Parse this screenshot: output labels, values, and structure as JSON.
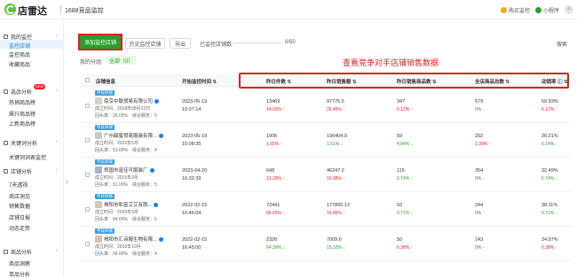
{
  "app": {
    "logo_text": "店雷达",
    "breadcrumb": "1688竞品监控"
  },
  "top_right": {
    "buy": "购买监控",
    "mini": "小程序",
    "avatar": "P"
  },
  "sidebar": {
    "groups": [
      {
        "label": "我的监控",
        "items": [
          "监控店铺",
          "监控商品",
          "收藏商品"
        ]
      },
      {
        "label": "选品分析",
        "badge": "NEW",
        "items": [
          "热销商品榜",
          "飙升商品榜",
          "上新商品榜"
        ]
      },
      {
        "label": "关键词分析",
        "items": [
          "关键词词表监控"
        ]
      },
      {
        "label": "店铺分析",
        "items": [
          "7天透视",
          "商店洞见",
          "销售数据",
          "店铺日报",
          "动态走势"
        ]
      },
      {
        "label": "商品分析",
        "items": [
          "商品洞察",
          "单品分析"
        ]
      }
    ]
  },
  "toolbar": {
    "add_label": "添加监控店铺",
    "history_label": "历史监控店铺",
    "export_label": "导出",
    "usage_label": "已监控店铺数:",
    "usage_value": "0",
    "usage_total": "/50",
    "usage_fraction": 0,
    "search_label": "搜索"
  },
  "groups_bar": {
    "label": "我的分组:",
    "all": "全部（0）"
  },
  "annotation": "查看竞争对手店铺销售数据",
  "table": {
    "headers": [
      "店铺信息",
      "开始监控时间",
      "昨日件数",
      "昨日销售额",
      "昨日销售商品数",
      "全店商品总数",
      "动销率"
    ],
    "rows": [
      {
        "tag": "字段商铺",
        "name": "南京中联贸易有限公司",
        "thumb": "#d9d2c5",
        "founded": "成立时间：2018年08月22日",
        "sales": "回头率：25.00%　综合服务：5",
        "date": "2023-05-19",
        "time": "15:07:14",
        "c1": "13469",
        "c1p": "14.03%",
        "c1s": "up",
        "c2": "97776.5",
        "c2p": "26.45%",
        "c2s": "up",
        "c3": "347",
        "c3p": "6.12%",
        "c3s": "up",
        "c4": "579",
        "c4p": "0%",
        "c4s": "flat",
        "c5": "59.93%",
        "c5p": "6.12%",
        "c5s": "up"
      },
      {
        "tag": "字段商铺",
        "name": "广州甜蜜贸易服装有限...",
        "thumb": "#c9c9c9",
        "founded": "成立时间：2022年5月",
        "sales": "回头率：51.00%　综合服务：4",
        "date": "2023-05-19",
        "time": "15:08:35",
        "c1": "1906",
        "c1p": "1.55%",
        "c1s": "up",
        "c2": "196404.9",
        "c2p": "1.51%",
        "c2s": "down",
        "c3": "59",
        "c3p": "4.84%",
        "c3s": "down",
        "c4": "292",
        "c4p": "1.39%",
        "c4s": "up",
        "c5": "20.21%",
        "c5p": "6.14%",
        "c5s": "down"
      },
      {
        "tag": "字段商铺",
        "name": "郑国市富佳可服装厂",
        "thumb": "#a8b8c8",
        "founded": "成立时间：2015年3月",
        "sales": "回头率：51.00%　综合服务：5",
        "date": "2023-04-20",
        "time": "16:32:39",
        "c1": "648",
        "c1p": "13.29%",
        "c1s": "up",
        "c2": "46247.2",
        "c2p": "15.08%",
        "c2s": "up",
        "c3": "115",
        "c3p": "5.74%",
        "c3s": "down",
        "c4": "354",
        "c4p": "0%",
        "c4s": "flat",
        "c5": "32.49%",
        "c5p": "5.74%",
        "c5s": "down"
      },
      {
        "tag": "字段商铺",
        "name": "揭阳市和富艾艾有限...",
        "thumb": "#cfc6b8",
        "founded": "成立时间：2020年9月",
        "sales": "回头率：64.00%　综合服务：5",
        "date": "2022-02-15",
        "time": "16:46:04",
        "c1": "72441",
        "c1p": "56.65%",
        "c1s": "up",
        "c2": "177865.12",
        "c2p": "16.86%",
        "c2s": "up",
        "c3": "93",
        "c3p": "9.71%",
        "c3s": "down",
        "c4": "244",
        "c4p": "0%",
        "c4s": "flat",
        "c5": "38.11%",
        "c5p": "9.71%",
        "c5s": "down"
      },
      {
        "tag": "字段商铺",
        "name": "揭阳市汇诗服生物有限...",
        "thumb": "#d6c3b0",
        "founded": "成立时间：2016年10月",
        "sales": "回头率：66.00%　综合服务：4",
        "date": "2022-02-15",
        "time": "16:45:00",
        "c1": "2326",
        "c1p": "64.39%",
        "c1s": "down",
        "c2": "7009.6",
        "c2p": "15.33%",
        "c2s": "down",
        "c3": "50",
        "c3p": "6.38%",
        "c3s": "up",
        "c4": "143",
        "c4p": "0%",
        "c4s": "flat",
        "c5": "34.97%",
        "c5p": "6.38%",
        "c5s": "up"
      }
    ]
  },
  "colors": {
    "green": "#2a9d2a",
    "red": "#e02020",
    "blue": "#1d7dea"
  }
}
